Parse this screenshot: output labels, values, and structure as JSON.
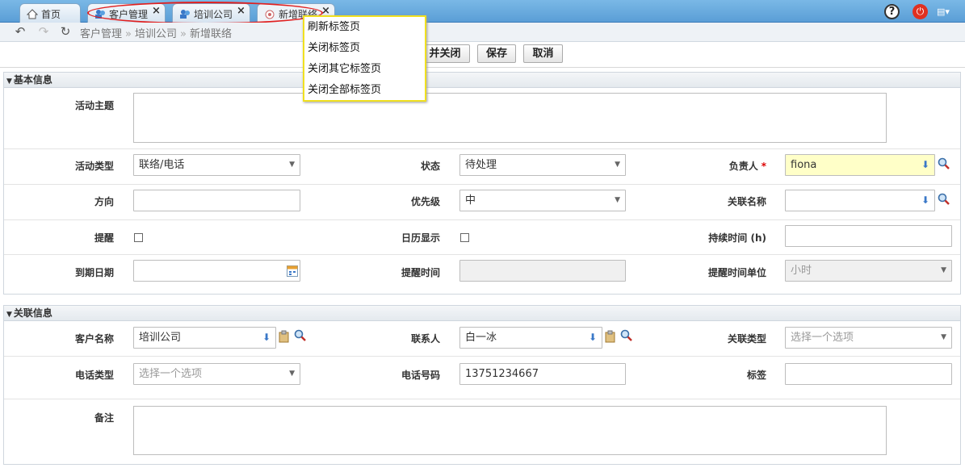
{
  "tabs": [
    {
      "label": "首页",
      "icon": "home-icon"
    },
    {
      "label": "客户管理",
      "icon": "customers-icon"
    },
    {
      "label": "培训公司",
      "icon": "company-icon"
    },
    {
      "label": "新增联络",
      "icon": "contact-icon"
    }
  ],
  "top_icons": [
    "help-icon",
    "power-icon",
    "theme-icon"
  ],
  "breadcrumb": {
    "items": [
      "客户管理",
      "培训公司",
      "新增联络"
    ],
    "separator": "»"
  },
  "context_menu": {
    "items": [
      "刷新标签页",
      "关闭标签页",
      "关闭其它标签页",
      "关闭全部标签页"
    ]
  },
  "buttons": {
    "save_close": "并关闭",
    "save": "保存",
    "cancel": "取消"
  },
  "sections": {
    "basic": "基本信息",
    "related": "关联信息"
  },
  "basic": {
    "subject_label": "活动主题",
    "type_label": "活动类型",
    "type_value": "联络/电话",
    "status_label": "状态",
    "status_value": "待处理",
    "owner_label": "负责人",
    "owner_value": "fiona",
    "required_mark": "*",
    "direction_label": "方向",
    "priority_label": "优先级",
    "priority_value": "中",
    "related_name_label": "关联名称",
    "remind_label": "提醒",
    "calendar_label": "日历显示",
    "duration_label": "持续时间 (h)",
    "due_label": "到期日期",
    "remind_time_label": "提醒时间",
    "remind_unit_label": "提醒时间单位",
    "remind_unit_value": "小时"
  },
  "related": {
    "customer_label": "客户名称",
    "customer_value": "培训公司",
    "contact_label": "联系人",
    "contact_value": "白一冰",
    "relation_type_label": "关联类型",
    "relation_type_placeholder": "选择一个选项",
    "phone_type_label": "电话类型",
    "phone_type_placeholder": "选择一个选项",
    "phone_label": "电话号码",
    "phone_value": "13751234667",
    "tag_label": "标签",
    "note_label": "备注"
  },
  "colors": {
    "tabbar": "#5a9ed6",
    "highlight": "#e02020",
    "menu_border": "#f0e020",
    "required_field": "#ffffc8"
  }
}
